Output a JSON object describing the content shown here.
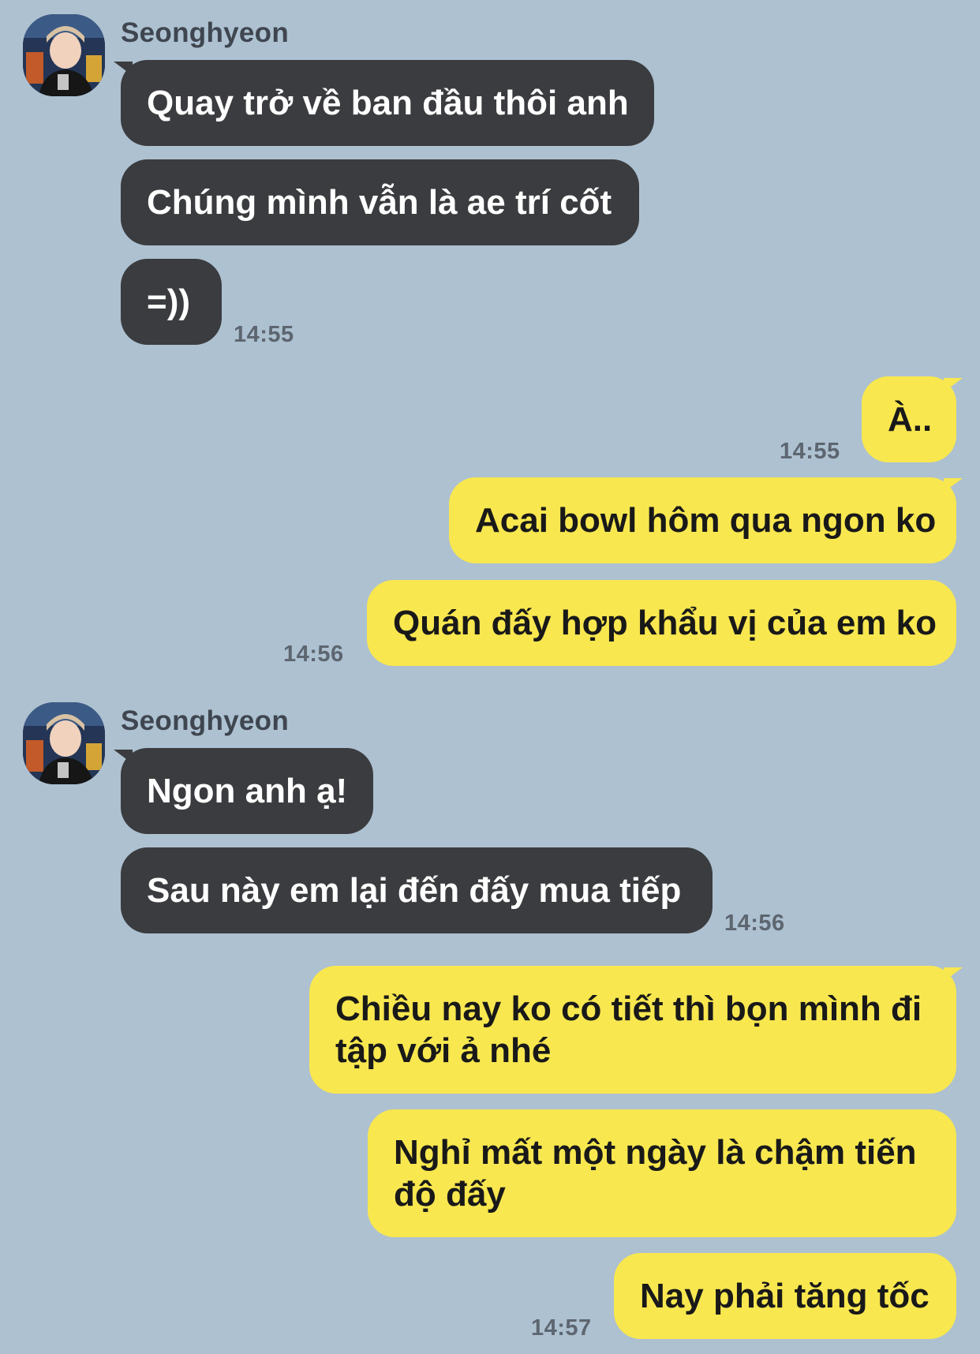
{
  "contact": {
    "name": "Seonghyeon"
  },
  "colors": {
    "background": "#adc1d1",
    "incoming_bubble": "#3b3c3f",
    "outgoing_bubble": "#f8e74f",
    "timestamp": "#5d6670"
  },
  "groups": [
    {
      "sender": "Seonghyeon",
      "direction": "incoming",
      "messages": [
        "Quay trở về ban đầu thôi anh",
        "Chúng mình vẫn là ae trí cốt",
        "=))"
      ],
      "time": "14:55"
    },
    {
      "direction": "outgoing",
      "messages": [
        "À.."
      ],
      "time": "14:55"
    },
    {
      "direction": "outgoing",
      "messages": [
        "Acai bowl hôm qua ngon ko",
        "Quán đấy hợp khẩu vị của em ko"
      ],
      "time": "14:56"
    },
    {
      "sender": "Seonghyeon",
      "direction": "incoming",
      "messages": [
        "Ngon anh ạ!",
        "Sau này em lại đến đấy mua tiếp"
      ],
      "time": "14:56"
    },
    {
      "direction": "outgoing",
      "messages": [
        "Chiều nay ko có tiết thì bọn mình đi tập với ả nhé",
        "Nghỉ mất một ngày là chậm tiến độ đấy",
        "Nay phải tăng tốc"
      ],
      "time": "14:57"
    }
  ]
}
